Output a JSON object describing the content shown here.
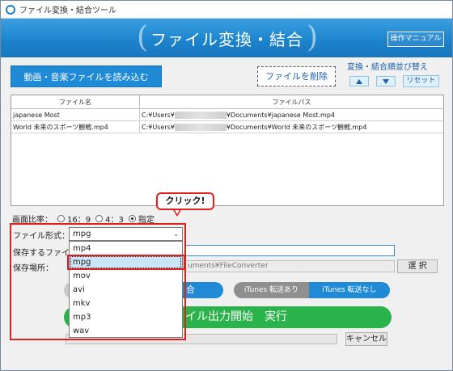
{
  "window": {
    "title": "ファイル変換・結合ツール",
    "heading": "ファイル変換・結合",
    "manual_button": "操作マニュアル",
    "app_icon": "refresh-icon"
  },
  "toolbar": {
    "load_button": "動画・音楽ファイルを読み込む",
    "delete_button": "ファイルを削除",
    "reorder_label": "変換・結合順並び替え",
    "up_icon": "triangle-up-icon",
    "down_icon": "triangle-down-icon",
    "reset_button": "リセット"
  },
  "file_table": {
    "headers": [
      "ファイル名",
      "ファイルパス"
    ],
    "rows": [
      {
        "name": "japanese Most",
        "path_prefix": "C:¥Users¥",
        "path_suffix": "¥Documents¥japanese Most.mp4"
      },
      {
        "name": "World 未来のスポーツ観戦.mp4",
        "path_prefix": "C:¥Users¥",
        "path_suffix": "¥Documents¥World 未来のスポーツ観戦.mp4"
      }
    ]
  },
  "settings": {
    "aspect_label": "画面比率：",
    "aspect_options": [
      "16：9",
      "4：3",
      "指定"
    ],
    "aspect_selected": "指定",
    "format_label": "ファイル形式：",
    "format_value": "mpg",
    "savename_label": "保存するファイル",
    "savepath_label": "保存場所：",
    "savepath_value": "uments¥FileConverter",
    "browse_button": "選 択"
  },
  "format_dropdown": {
    "options": [
      "mp4",
      "mpg",
      "mov",
      "avi",
      "mkv",
      "mp3",
      "wav"
    ],
    "hovered": "mpg"
  },
  "actions": {
    "combine_label": "合",
    "itunes_on": "iTunes 転送あり",
    "itunes_off": "iTunes 転送なし",
    "start_label": "イル出力開始　実行",
    "cancel_button": "キャンセル"
  },
  "annotation": {
    "callout": "クリック!",
    "color": "#e02020"
  }
}
